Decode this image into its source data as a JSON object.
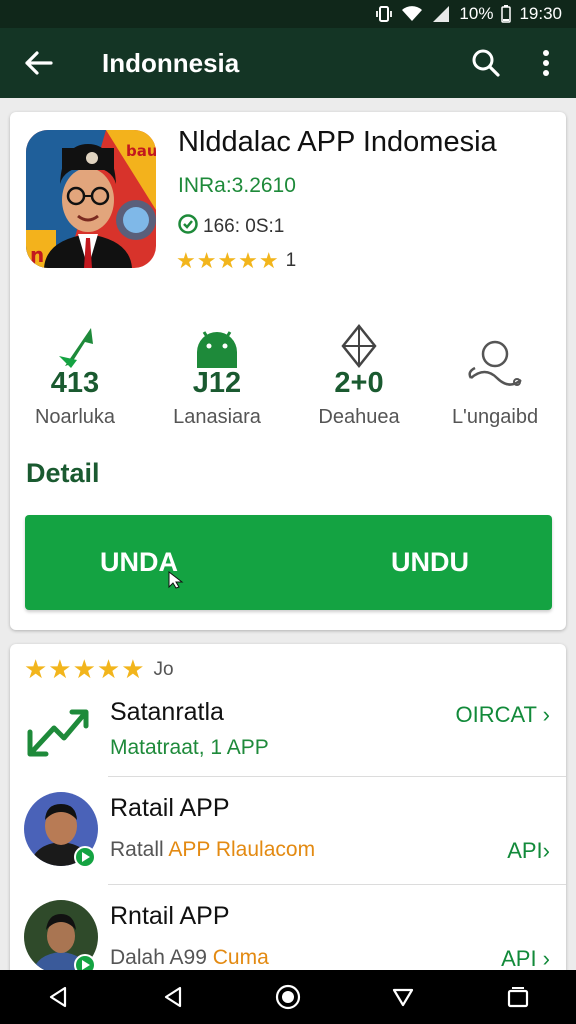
{
  "status_bar": {
    "battery": "10%",
    "time": "19:30",
    "icons": [
      "vibrate-icon",
      "wifi-icon",
      "signal-icon"
    ]
  },
  "app_bar": {
    "title": "Indonnesia",
    "icons": [
      "back-arrow-icon",
      "search-icon",
      "more-vert-icon"
    ]
  },
  "app": {
    "name": "Nlddalac APP Indomesia",
    "subtitle": "INRa:3.2610",
    "meta": "166: 0S:1",
    "rating_stars": 4.5,
    "rating_count": "1"
  },
  "stats": [
    {
      "value": "413",
      "label": "Noarluka",
      "icon": "download-arrow-icon"
    },
    {
      "value": "J12",
      "label": "Lanasiara",
      "icon": "android-icon"
    },
    {
      "value": "2+0",
      "label": "Deahuea",
      "icon": "kite-icon"
    },
    {
      "value": "",
      "label": "L'ungaibd",
      "icon": "user-outline-icon"
    }
  ],
  "detail_label": "Detail",
  "install_button": {
    "label_left": "UNDA",
    "label_right": "UNDU"
  },
  "list": {
    "header_stars": 4.5,
    "header_text": "Jo",
    "items": [
      {
        "name": "Satanratla",
        "desc": "Matatraat, 1 APP",
        "desc_highlight": "",
        "link": "OIRCAT ›"
      },
      {
        "name": "Ratail APP",
        "desc": "Ratall ",
        "desc_highlight": "APP Rlaulacom",
        "link": "API›"
      },
      {
        "name": "Rntail APP",
        "desc": "Dalah A99 ",
        "desc_highlight": "Cuma",
        "link": "API ›"
      }
    ]
  },
  "nav_bar": {
    "icons": [
      "back-triangle-icon",
      "back-triangle-icon",
      "home-circle-icon",
      "down-triangle-icon",
      "recents-icon"
    ]
  },
  "colors": {
    "app_bar": "#143525",
    "status_bar": "#10271a",
    "accent_green": "#14a342",
    "dark_green": "#1a5a30",
    "star": "#f2b51c",
    "highlight_orange": "#e38a12"
  }
}
